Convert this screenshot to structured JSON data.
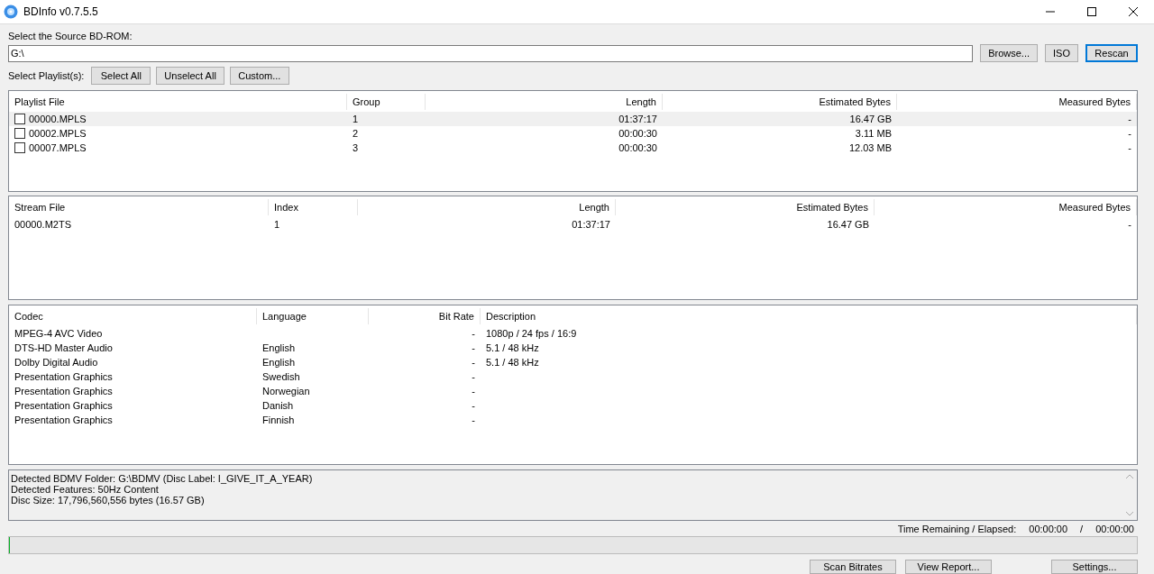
{
  "window": {
    "title": "BDInfo v0.7.5.5"
  },
  "source": {
    "label": "Select the Source BD-ROM:",
    "value": "G:\\",
    "buttons": [
      {
        "label": "Browse...",
        "selected": false
      },
      {
        "label": "ISO",
        "selected": false
      },
      {
        "label": "Rescan",
        "selected": true
      }
    ]
  },
  "playlist_bar": {
    "label": "Select Playlist(s):",
    "buttons": [
      "Select All",
      "Unselect All",
      "Custom..."
    ]
  },
  "playlists": {
    "columns": [
      "Playlist File",
      "Group",
      "Length",
      "Estimated Bytes",
      "Measured Bytes"
    ],
    "rows": [
      {
        "checked": false,
        "selected": true,
        "cells": [
          "00000.MPLS",
          "1",
          "01:37:17",
          "16.47 GB",
          "-"
        ]
      },
      {
        "checked": false,
        "selected": false,
        "cells": [
          "00002.MPLS",
          "2",
          "00:00:30",
          "3.11 MB",
          "-"
        ]
      },
      {
        "checked": false,
        "selected": false,
        "cells": [
          "00007.MPLS",
          "3",
          "00:00:30",
          "12.03 MB",
          "-"
        ]
      }
    ]
  },
  "streams": {
    "columns": [
      "Stream File",
      "Index",
      "Length",
      "Estimated Bytes",
      "Measured Bytes"
    ],
    "rows": [
      {
        "cells": [
          "00000.M2TS",
          "1",
          "01:37:17",
          "16.47 GB",
          "-"
        ]
      }
    ]
  },
  "codecs": {
    "columns": [
      "Codec",
      "Language",
      "Bit Rate",
      "Description"
    ],
    "rows": [
      {
        "cells": [
          "MPEG-4 AVC Video",
          "",
          "-",
          "1080p / 24 fps / 16:9"
        ]
      },
      {
        "cells": [
          "DTS-HD Master Audio",
          "English",
          "-",
          "5.1 / 48 kHz"
        ]
      },
      {
        "cells": [
          "Dolby Digital Audio",
          "English",
          "-",
          "5.1 / 48 kHz"
        ]
      },
      {
        "cells": [
          "Presentation Graphics",
          "Swedish",
          "-",
          ""
        ]
      },
      {
        "cells": [
          "Presentation Graphics",
          "Norwegian",
          "-",
          ""
        ]
      },
      {
        "cells": [
          "Presentation Graphics",
          "Danish",
          "-",
          ""
        ]
      },
      {
        "cells": [
          "Presentation Graphics",
          "Finnish",
          "-",
          ""
        ]
      }
    ]
  },
  "info": [
    "Detected BDMV Folder: G:\\BDMV (Disc Label: I_GIVE_IT_A_YEAR)",
    "Detected Features: 50Hz Content",
    "Disc Size: 17,796,560,556 bytes (16.57 GB)"
  ],
  "time": {
    "label": "Time Remaining / Elapsed:",
    "remaining": "00:00:00",
    "separator": "/",
    "elapsed": "00:00:00"
  },
  "progress": {
    "level": 0
  },
  "footer_buttons": [
    "Scan Bitrates",
    "View Report...",
    "Settings..."
  ]
}
